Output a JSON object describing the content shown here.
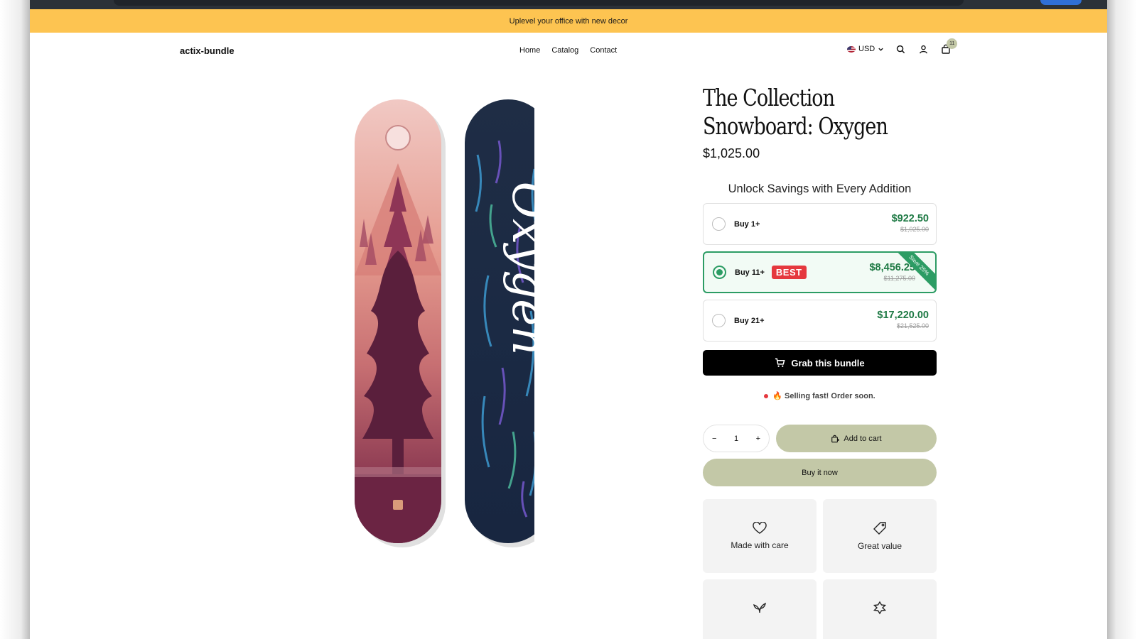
{
  "announcement": "Uplevel your office with new decor",
  "header": {
    "logo": "actix-bundle",
    "nav": [
      "Home",
      "Catalog",
      "Contact"
    ],
    "currency": "USD",
    "cart_count": "11"
  },
  "product": {
    "title_line1": "The Collection",
    "title_line2": "Snowboard: Oxygen",
    "price": "$1,025.00",
    "media_text": "Oxygen"
  },
  "bundle": {
    "heading": "Unlock Savings with Every Addition",
    "options": [
      {
        "label": "Buy 1+",
        "price": "$922.50",
        "compare": "$1,025.00",
        "selected": false
      },
      {
        "label": "Buy 11+",
        "badge": "BEST",
        "price": "$8,456.25",
        "compare": "$11,275.00",
        "ribbon": "Save 25%",
        "selected": true
      },
      {
        "label": "Buy 21+",
        "price": "$17,220.00",
        "compare": "$21,525.00",
        "selected": false
      }
    ],
    "cta": "Grab this bundle"
  },
  "urgency": "🔥 Selling fast! Order soon.",
  "cart": {
    "quantity": "1",
    "minus": "−",
    "plus": "+",
    "add_to_cart": "Add to cart",
    "buy_now": "Buy it now"
  },
  "features": [
    {
      "icon": "heart-icon",
      "label": "Made with care"
    },
    {
      "icon": "tag-icon",
      "label": "Great value"
    },
    {
      "icon": "leaf-icon",
      "label": ""
    },
    {
      "icon": "puzzle-icon",
      "label": ""
    }
  ],
  "colors": {
    "announcement_bg": "#fdc451",
    "accent_green": "#2c9c64",
    "price_green": "#1f7a45",
    "best_red": "#e5383e",
    "button_olive": "#c3c8a7"
  }
}
